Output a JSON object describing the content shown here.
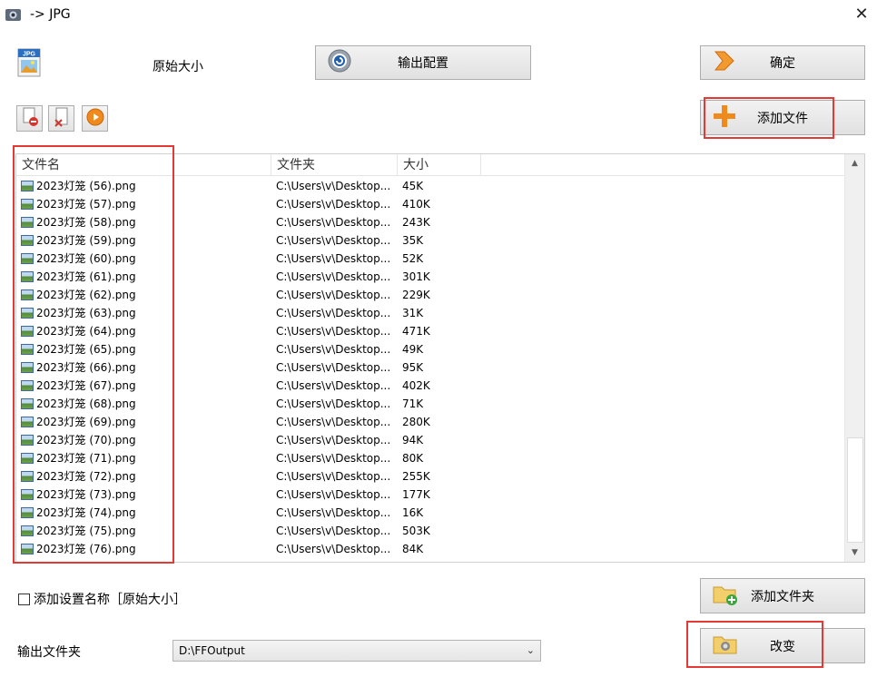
{
  "window": {
    "title": "-> JPG",
    "close": "✕"
  },
  "header": {
    "format_badge": "JPG",
    "quality_label": "原始大小",
    "output_config_label": "输出配置",
    "ok_label": "确定",
    "add_file_label": "添加文件"
  },
  "list": {
    "columns": [
      "文件名",
      "文件夹",
      "大小"
    ],
    "rows": [
      {
        "name": "2023灯笼 (56).png",
        "folder": "C:\\Users\\v\\Desktop...",
        "size": "45K"
      },
      {
        "name": "2023灯笼 (57).png",
        "folder": "C:\\Users\\v\\Desktop...",
        "size": "410K"
      },
      {
        "name": "2023灯笼 (58).png",
        "folder": "C:\\Users\\v\\Desktop...",
        "size": "243K"
      },
      {
        "name": "2023灯笼 (59).png",
        "folder": "C:\\Users\\v\\Desktop...",
        "size": "35K"
      },
      {
        "name": "2023灯笼 (60).png",
        "folder": "C:\\Users\\v\\Desktop...",
        "size": "52K"
      },
      {
        "name": "2023灯笼 (61).png",
        "folder": "C:\\Users\\v\\Desktop...",
        "size": "301K"
      },
      {
        "name": "2023灯笼 (62).png",
        "folder": "C:\\Users\\v\\Desktop...",
        "size": "229K"
      },
      {
        "name": "2023灯笼 (63).png",
        "folder": "C:\\Users\\v\\Desktop...",
        "size": "31K"
      },
      {
        "name": "2023灯笼 (64).png",
        "folder": "C:\\Users\\v\\Desktop...",
        "size": "471K"
      },
      {
        "name": "2023灯笼 (65).png",
        "folder": "C:\\Users\\v\\Desktop...",
        "size": "49K"
      },
      {
        "name": "2023灯笼 (66).png",
        "folder": "C:\\Users\\v\\Desktop...",
        "size": "95K"
      },
      {
        "name": "2023灯笼 (67).png",
        "folder": "C:\\Users\\v\\Desktop...",
        "size": "402K"
      },
      {
        "name": "2023灯笼 (68).png",
        "folder": "C:\\Users\\v\\Desktop...",
        "size": "71K"
      },
      {
        "name": "2023灯笼 (69).png",
        "folder": "C:\\Users\\v\\Desktop...",
        "size": "280K"
      },
      {
        "name": "2023灯笼 (70).png",
        "folder": "C:\\Users\\v\\Desktop...",
        "size": "94K"
      },
      {
        "name": "2023灯笼 (71).png",
        "folder": "C:\\Users\\v\\Desktop...",
        "size": "80K"
      },
      {
        "name": "2023灯笼 (72).png",
        "folder": "C:\\Users\\v\\Desktop...",
        "size": "255K"
      },
      {
        "name": "2023灯笼 (73).png",
        "folder": "C:\\Users\\v\\Desktop...",
        "size": "177K"
      },
      {
        "name": "2023灯笼 (74).png",
        "folder": "C:\\Users\\v\\Desktop...",
        "size": "16K"
      },
      {
        "name": "2023灯笼 (75).png",
        "folder": "C:\\Users\\v\\Desktop...",
        "size": "503K"
      },
      {
        "name": "2023灯笼 (76).png",
        "folder": "C:\\Users\\v\\Desktop...",
        "size": "84K"
      }
    ]
  },
  "footer": {
    "add_setting_name_label": "添加设置名称［原始大小］",
    "add_setting_name_checked": false,
    "add_folder_label": "添加文件夹",
    "output_folder_label": "输出文件夹",
    "output_folder_value": "D:\\FFOutput",
    "change_label": "改变"
  },
  "icons": {
    "app": "app-icon",
    "format": "jpg-file-icon",
    "output_config": "gear-icon",
    "ok": "arrow-right-icon",
    "add_file": "plus-icon",
    "remove": "remove-file-icon",
    "clear": "clear-list-icon",
    "play": "play-icon",
    "add_folder": "folder-add-icon",
    "change": "folder-camera-icon"
  },
  "colors": {
    "highlight": "#e53935",
    "accent_orange": "#f08a1c",
    "button_bg": "#e6e6e6"
  }
}
